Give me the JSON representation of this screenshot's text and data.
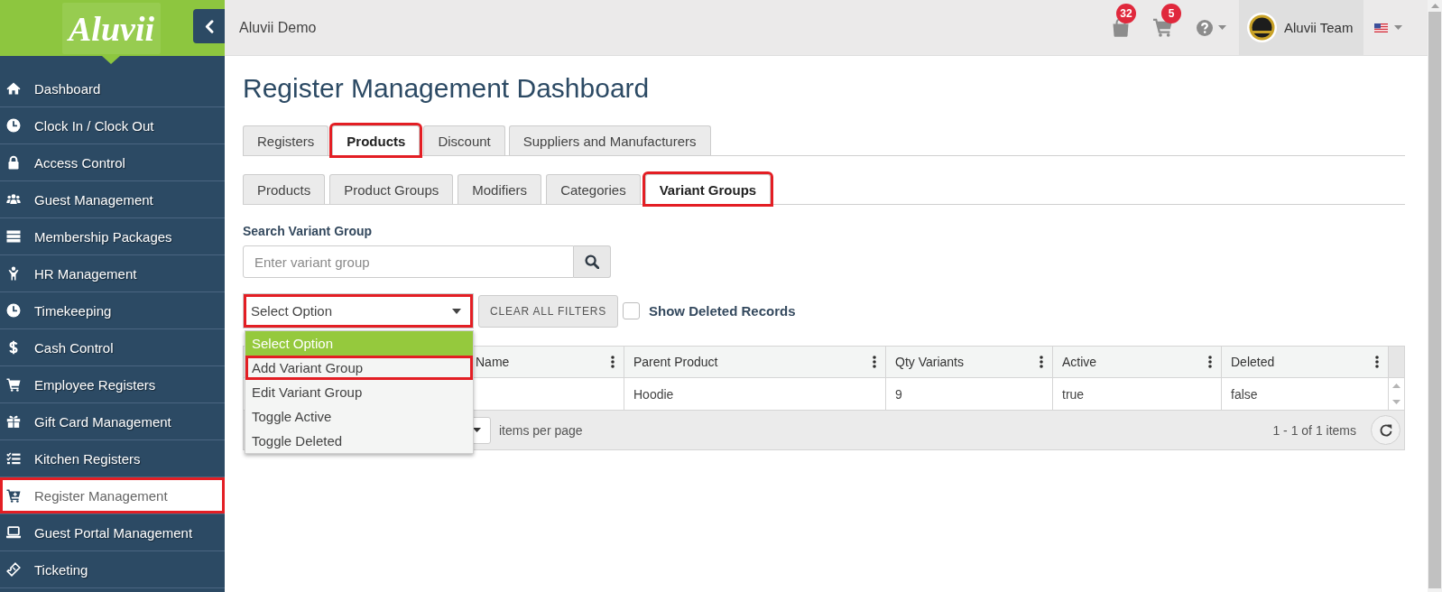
{
  "sidebar": {
    "logo": "Aluvii",
    "items": [
      {
        "label": "Dashboard",
        "selected": false,
        "highlighted": false
      },
      {
        "label": "Clock In / Clock Out",
        "selected": false,
        "highlighted": false
      },
      {
        "label": "Access Control",
        "selected": false,
        "highlighted": false
      },
      {
        "label": "Guest Management",
        "selected": false,
        "highlighted": false
      },
      {
        "label": "Membership Packages",
        "selected": false,
        "highlighted": false
      },
      {
        "label": "HR Management",
        "selected": false,
        "highlighted": false
      },
      {
        "label": "Timekeeping",
        "selected": false,
        "highlighted": false
      },
      {
        "label": "Cash Control",
        "selected": false,
        "highlighted": false
      },
      {
        "label": "Employee Registers",
        "selected": false,
        "highlighted": false
      },
      {
        "label": "Gift Card Management",
        "selected": false,
        "highlighted": false
      },
      {
        "label": "Kitchen Registers",
        "selected": false,
        "highlighted": false
      },
      {
        "label": "Register Management",
        "selected": true,
        "highlighted": true
      },
      {
        "label": "Guest Portal Management",
        "selected": false,
        "highlighted": false
      },
      {
        "label": "Ticketing",
        "selected": false,
        "highlighted": false
      }
    ]
  },
  "topbar": {
    "title": "Aluvii Demo",
    "notifications": [
      {
        "count": "32"
      },
      {
        "count": "5"
      }
    ],
    "user": "Aluvii Team"
  },
  "page_title": "Register Management Dashboard",
  "tabs": [
    {
      "label": "Registers",
      "selected": false,
      "highlighted": false
    },
    {
      "label": "Products",
      "selected": true,
      "highlighted": true
    },
    {
      "label": "Discount",
      "selected": false,
      "highlighted": false
    },
    {
      "label": "Suppliers and Manufacturers",
      "selected": false,
      "highlighted": false
    }
  ],
  "subtabs": [
    {
      "label": "Products",
      "selected": false,
      "highlighted": false
    },
    {
      "label": "Product Groups",
      "selected": false,
      "highlighted": false
    },
    {
      "label": "Modifiers",
      "selected": false,
      "highlighted": false
    },
    {
      "label": "Categories",
      "selected": false,
      "highlighted": false
    },
    {
      "label": "Variant Groups",
      "selected": true,
      "highlighted": true
    }
  ],
  "search": {
    "label": "Search Variant Group",
    "placeholder": "Enter variant group"
  },
  "filters": {
    "select": {
      "value": "Select Option",
      "highlighted": true,
      "expanded": true,
      "options": [
        {
          "label": "Select Option",
          "selected": true,
          "highlighted": false
        },
        {
          "label": "Add Variant Group",
          "selected": false,
          "highlighted": true
        },
        {
          "label": "Edit Variant Group",
          "selected": false,
          "highlighted": false
        },
        {
          "label": "Toggle Active",
          "selected": false,
          "highlighted": false
        },
        {
          "label": "Toggle Deleted",
          "selected": false,
          "highlighted": false
        }
      ]
    },
    "clear_button": "CLEAR ALL FILTERS",
    "show_deleted": {
      "label": "Show Deleted Records",
      "checked": false
    }
  },
  "grid": {
    "columns": [
      {
        "label": "Name"
      },
      {
        "label": "Parent Product",
        "cells": [
          "Hoodie"
        ]
      },
      {
        "label": "Qty Variants",
        "cells": [
          "9"
        ]
      },
      {
        "label": "Active",
        "cells": [
          "true"
        ]
      },
      {
        "label": "Deleted",
        "cells": [
          "false"
        ]
      }
    ],
    "pager": {
      "page_size_label": "items per page",
      "summary": "1 - 1 of 1 items"
    }
  }
}
